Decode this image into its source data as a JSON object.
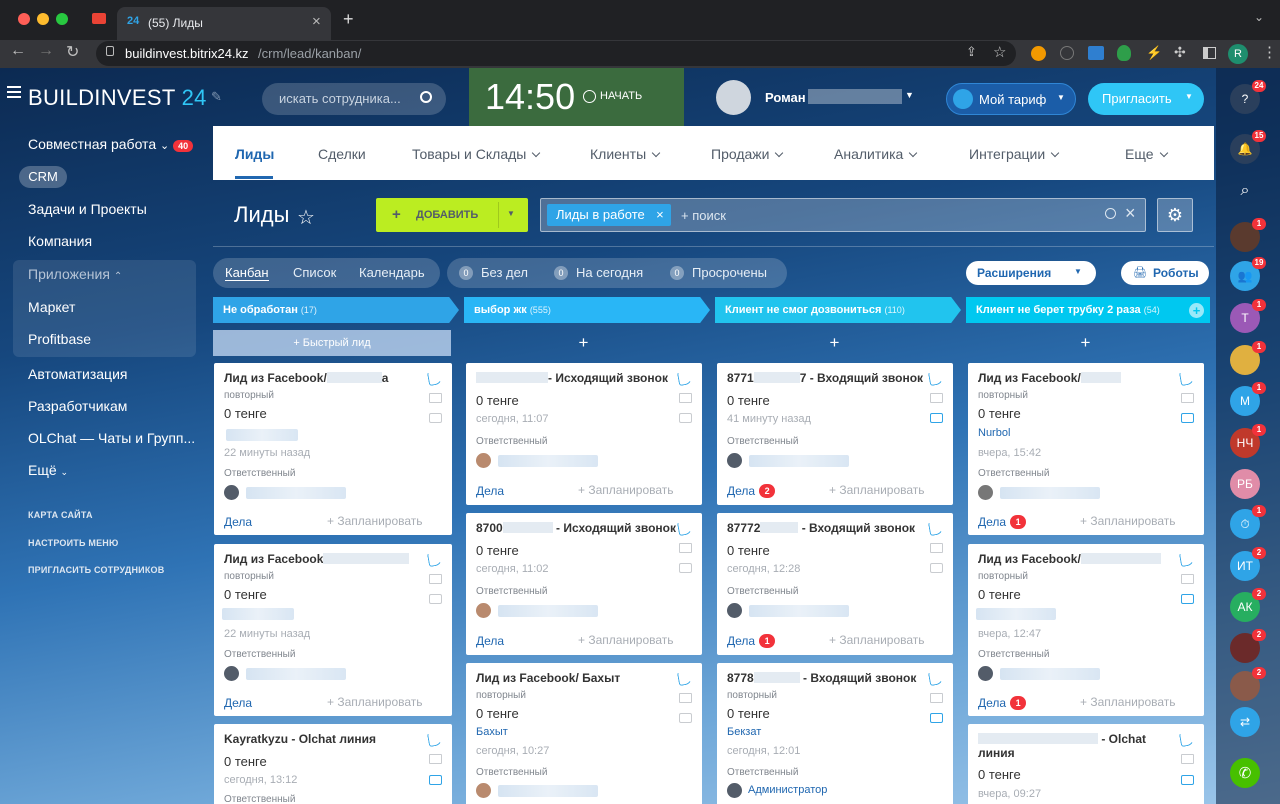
{
  "browser": {
    "tab_title": "(55) Лиды",
    "url_host": "buildinvest.bitrix24.kz",
    "url_path": "/crm/lead/kanban/",
    "profile": "R"
  },
  "header": {
    "logo_a": "BUILDINVEST",
    "logo_b": "24",
    "search_placeholder": "искать сотрудника...",
    "time": "14:50",
    "start_label": "НАЧАТЬ",
    "user_name": "Роман",
    "tariff": "Мой тариф",
    "invite": "Пригласить"
  },
  "leftnav": {
    "items": [
      {
        "label": "Совместная работа",
        "badge": "40"
      },
      {
        "label": "CRM"
      },
      {
        "label": "Задачи и Проекты"
      },
      {
        "label": "Компания"
      },
      {
        "label": "Приложения"
      },
      {
        "label": "Маркет"
      },
      {
        "label": "Profitbase"
      },
      {
        "label": "Автоматизация"
      },
      {
        "label": "Разработчикам"
      },
      {
        "label": "OLChat — Чаты и Групп..."
      },
      {
        "label": "Ещё"
      }
    ],
    "small": [
      "КАРТА САЙТА",
      "НАСТРОИТЬ МЕНЮ",
      "ПРИГЛАСИТЬ СОТРУДНИКОВ"
    ]
  },
  "menu": [
    "Лиды",
    "Сделки",
    "Товары и Склады",
    "Клиенты",
    "Продажи",
    "Аналитика",
    "Интеграции",
    "Еще"
  ],
  "page": {
    "title": "Лиды",
    "add_label": "ДОБАВИТЬ",
    "filter_tag": "Лиды в работе",
    "filter_placeholder": "+ поиск"
  },
  "views": [
    "Канбан",
    "Список",
    "Календарь"
  ],
  "counters": [
    {
      "n": "0",
      "label": "Без дел"
    },
    {
      "n": "0",
      "label": "На сегодня"
    },
    {
      "n": "0",
      "label": "Просрочены"
    }
  ],
  "extensions": "Расширения",
  "robots": "Роботы",
  "columns": [
    {
      "title": "Не обработан",
      "count": "(17)",
      "color": "#2fa4e7",
      "add": "+ Быстрый лид"
    },
    {
      "title": "выбор жк",
      "count": "(555)",
      "color": "#29b6f6",
      "add": "+"
    },
    {
      "title": "Клиент не смог дозвониться",
      "count": "(110)",
      "color": "#21c4ee",
      "add": "+"
    },
    {
      "title": "Клиент не берет трубку 2 раза",
      "count": "(54)",
      "color": "#00c8f0",
      "add": "+"
    }
  ],
  "cards": {
    "c1a": {
      "title": "Лид из Facebook/",
      "tail": "а",
      "sub": "повторный",
      "amount": "0 тенге",
      "time": "22 минуты назад",
      "resp": "Ответственный",
      "deal": "Дела",
      "plan": "+ Запланировать"
    },
    "c1b": {
      "title": "Лид из Facebook",
      "sub": "повторный",
      "amount": "0 тенге",
      "time": "22 минуты назад",
      "resp": "Ответственный",
      "deal": "Дела",
      "plan": "+ Запланировать"
    },
    "c1c": {
      "title": "Kayratkyzu - Olchat линия",
      "amount": "0 тенге",
      "time": "сегодня, 13:12",
      "resp": "Ответственный"
    },
    "c2a": {
      "title": "- Исходящий звонок",
      "amount": "0 тенге",
      "time": "сегодня, 11:07",
      "resp": "Ответственный",
      "deal": "Дела",
      "plan": "+ Запланировать"
    },
    "c2b": {
      "title": "8700",
      "tail": "- Исходящий звонок",
      "amount": "0 тенге",
      "time": "сегодня, 11:02",
      "resp": "Ответственный",
      "deal": "Дела",
      "plan": "+ Запланировать"
    },
    "c2c": {
      "title": "Лид из Facebook/ Бахыт",
      "sub": "повторный",
      "amount": "0 тенге",
      "link": "Бахыт",
      "time": "сегодня, 10:27",
      "resp": "Ответственный"
    },
    "c3a": {
      "title": "8771",
      "tail": "7 - Входящий звонок",
      "amount": "0 тенге",
      "time": "41 минуту назад",
      "resp": "Ответственный",
      "deal": "Дела",
      "badge": "2",
      "plan": "+ Запланировать"
    },
    "c3b": {
      "title": "87772",
      "tail": "- Входящий звонок",
      "amount": "0 тенге",
      "time": "сегодня, 12:28",
      "resp": "Ответственный",
      "deal": "Дела",
      "badge": "1",
      "plan": "+ Запланировать"
    },
    "c3c": {
      "title": "8778",
      "tail": "- Входящий звонок",
      "sub": "повторный",
      "amount": "0 тенге",
      "link": "Бекзат",
      "time": "сегодня, 12:01",
      "resp": "Ответственный",
      "owner": "Администратор"
    },
    "c4a": {
      "title": "Лид из Facebook/",
      "sub": "повторный",
      "amount": "0 тенге",
      "link": "Nurbol",
      "time": "вчера, 15:42",
      "resp": "Ответственный",
      "deal": "Дела",
      "badge": "1",
      "plan": "+ Запланировать"
    },
    "c4b": {
      "title": "Лид из Facebook/",
      "sub": "повторный",
      "amount": "0 тенге",
      "time": "вчера, 12:47",
      "resp": "Ответственный",
      "deal": "Дела",
      "badge": "1",
      "plan": "+ Запланировать"
    },
    "c4c": {
      "title": "- Olchat",
      "title2": "линия",
      "amount": "0 тенге",
      "time": "вчера, 09:27"
    }
  },
  "rightbar": [
    {
      "icon": "help-icon",
      "badge": "24"
    },
    {
      "icon": "bell-icon",
      "badge": "15"
    },
    {
      "icon": "search-icon"
    },
    {
      "badge": "1"
    },
    {
      "badge": "19"
    },
    {
      "text": "Т",
      "color": "#9b59b6",
      "badge": "1"
    },
    {
      "badge": "1"
    },
    {
      "text": "М",
      "color": "#2fa4e7",
      "badge": "1"
    },
    {
      "text": "НЧ",
      "color": "#c0392b",
      "badge": "1"
    },
    {
      "text": "РБ",
      "color": "#e08ca8"
    },
    {
      "badge": "1"
    },
    {
      "text": "ИТ",
      "color": "#2fa4e7",
      "badge": "2"
    },
    {
      "text": "АК",
      "color": "#27ae60",
      "badge": "2"
    },
    {
      "badge": "2"
    },
    {
      "badge": "2"
    }
  ]
}
